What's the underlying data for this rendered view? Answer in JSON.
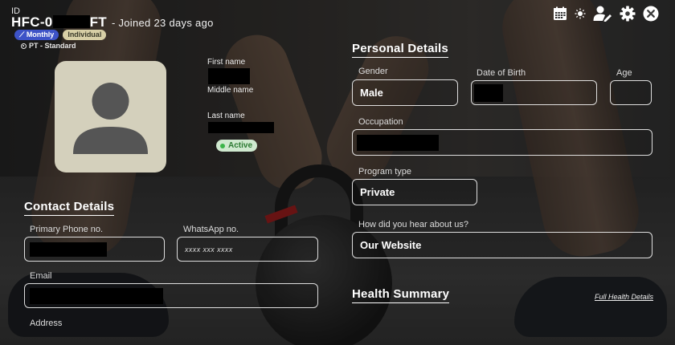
{
  "header": {
    "id_label": "ID",
    "member_id_prefix": "HFC-0",
    "member_id_suffix": "FT",
    "joined": "- Joined 23 days ago",
    "badges": [
      "Monthly",
      "Individual"
    ],
    "plan": "PT - Standard",
    "icons": [
      "calendar-icon",
      "sun-icon",
      "edit-user-icon",
      "gear-icon",
      "close-icon"
    ]
  },
  "profile": {
    "first_name_label": "First name",
    "middle_name_label": "Middle name",
    "last_name_label": "Last name",
    "status": "Active",
    "status_color": "#3cb54a"
  },
  "contact": {
    "title": "Contact Details",
    "primary_phone_label": "Primary Phone no.",
    "whatsapp_label": "WhatsApp no.",
    "whatsapp_placeholder": "xxxx xxx xxxx",
    "email_label": "Email",
    "address_label": "Address"
  },
  "personal": {
    "title": "Personal Details",
    "gender_label": "Gender",
    "gender_value": "Male",
    "dob_label": "Date of Birth",
    "age_label": "Age",
    "occupation_label": "Occupation",
    "program_type_label": "Program type",
    "program_type_value": "Private",
    "referral_label": "How did you hear about us?",
    "referral_value": "Our Website"
  },
  "health": {
    "title": "Health Summary",
    "link": "Full Health Details"
  },
  "colors": {
    "monthly_badge": "#3d53c7",
    "individual_badge": "#d7cfa6",
    "avatar_bg": "#d4d0bc"
  }
}
